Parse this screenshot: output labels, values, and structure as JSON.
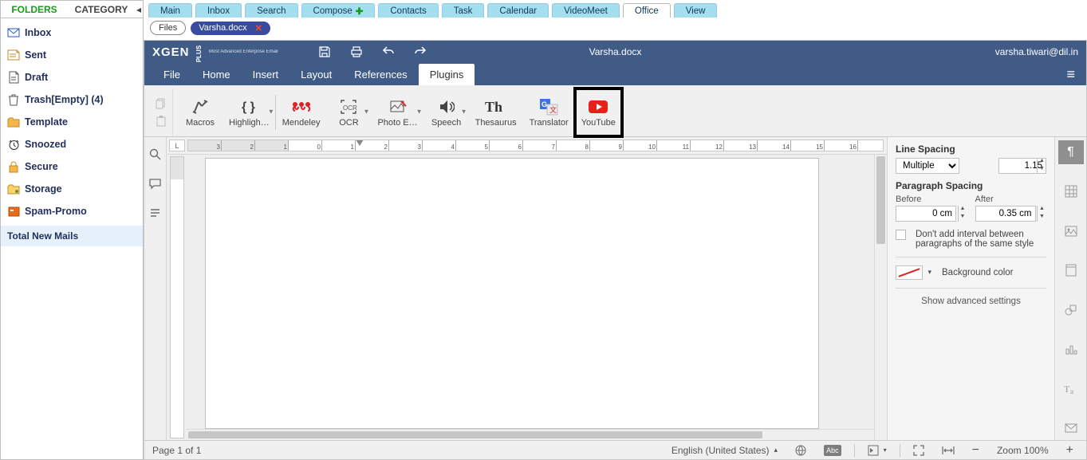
{
  "sidebar": {
    "tab_folders": "FOLDERS",
    "tab_category": "CATEGORY",
    "items": [
      {
        "label": "Inbox"
      },
      {
        "label": "Sent"
      },
      {
        "label": "Draft"
      },
      {
        "label": "Trash[Empty] (4)"
      },
      {
        "label": "Template"
      },
      {
        "label": "Snoozed"
      },
      {
        "label": "Secure"
      },
      {
        "label": "Storage"
      },
      {
        "label": "Spam-Promo"
      }
    ],
    "footer": "Total New Mails"
  },
  "chrome_tabs": {
    "items": [
      "Main",
      "Inbox",
      "Search",
      "Compose",
      "Contacts",
      "Task",
      "Calendar",
      "VideoMeet",
      "Office",
      "View"
    ],
    "active": "Office",
    "compose_has_plus": true
  },
  "filebar": {
    "files_label": "Files",
    "doc_name": "Varsha.docx"
  },
  "titlebar": {
    "logo": "XGEN",
    "logo_suffix": "PLUS",
    "tagline": "Most Advanced Enterprise Email",
    "doc_title": "Varsha.docx",
    "user": "varsha.tiwari@dil.in"
  },
  "menu": {
    "items": [
      "File",
      "Home",
      "Insert",
      "Layout",
      "References",
      "Plugins"
    ],
    "active": "Plugins"
  },
  "ribbon": {
    "tools": [
      {
        "label": "Macros"
      },
      {
        "label": "Highligh…",
        "caret": true,
        "sep": true
      },
      {
        "label": "Mendeley"
      },
      {
        "label": "OCR",
        "caret": true
      },
      {
        "label": "Photo E…",
        "caret": true
      },
      {
        "label": "Speech",
        "caret": true
      },
      {
        "label": "Thesaurus"
      },
      {
        "label": "Translator"
      },
      {
        "label": "YouTube",
        "highlight": true
      }
    ]
  },
  "ruler": {
    "min": -3,
    "max": 18,
    "indent_at": 2
  },
  "props": {
    "line_spacing_title": "Line Spacing",
    "line_spacing_mode": "Multiple",
    "line_spacing_value": "1.15",
    "para_title": "Paragraph Spacing",
    "before_label": "Before",
    "after_label": "After",
    "before_value": "0 cm",
    "after_value": "0.35 cm",
    "no_interval": "Don't add interval between paragraphs of the same style",
    "bg_label": "Background color",
    "advanced": "Show advanced settings"
  },
  "status": {
    "page": "Page 1 of 1",
    "lang": "English (United States)",
    "zoom": "Zoom 100%"
  }
}
